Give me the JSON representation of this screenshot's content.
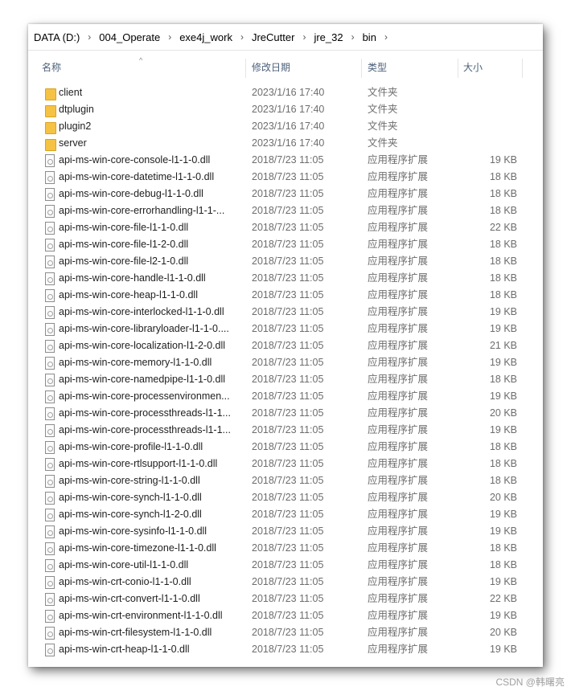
{
  "breadcrumb": [
    "DATA (D:)",
    "004_Operate",
    "exe4j_work",
    "JreCutter",
    "jre_32",
    "bin"
  ],
  "breadcrumb_separator": "›",
  "columns": {
    "name": "名称",
    "date": "修改日期",
    "type": "类型",
    "size": "大小"
  },
  "sort_arrow": "^",
  "files": [
    {
      "name": "client",
      "date": "2023/1/16 17:40",
      "type": "文件夹",
      "size": "",
      "icon": "folder-icon"
    },
    {
      "name": "dtplugin",
      "date": "2023/1/16 17:40",
      "type": "文件夹",
      "size": "",
      "icon": "folder-icon"
    },
    {
      "name": "plugin2",
      "date": "2023/1/16 17:40",
      "type": "文件夹",
      "size": "",
      "icon": "folder-icon"
    },
    {
      "name": "server",
      "date": "2023/1/16 17:40",
      "type": "文件夹",
      "size": "",
      "icon": "folder-icon"
    },
    {
      "name": "api-ms-win-core-console-l1-1-0.dll",
      "date": "2018/7/23 11:05",
      "type": "应用程序扩展",
      "size": "19 KB",
      "icon": "dll-file-icon"
    },
    {
      "name": "api-ms-win-core-datetime-l1-1-0.dll",
      "date": "2018/7/23 11:05",
      "type": "应用程序扩展",
      "size": "18 KB",
      "icon": "dll-file-icon"
    },
    {
      "name": "api-ms-win-core-debug-l1-1-0.dll",
      "date": "2018/7/23 11:05",
      "type": "应用程序扩展",
      "size": "18 KB",
      "icon": "dll-file-icon"
    },
    {
      "name": "api-ms-win-core-errorhandling-l1-1-...",
      "date": "2018/7/23 11:05",
      "type": "应用程序扩展",
      "size": "18 KB",
      "icon": "dll-file-icon"
    },
    {
      "name": "api-ms-win-core-file-l1-1-0.dll",
      "date": "2018/7/23 11:05",
      "type": "应用程序扩展",
      "size": "22 KB",
      "icon": "dll-file-icon"
    },
    {
      "name": "api-ms-win-core-file-l1-2-0.dll",
      "date": "2018/7/23 11:05",
      "type": "应用程序扩展",
      "size": "18 KB",
      "icon": "dll-file-icon"
    },
    {
      "name": "api-ms-win-core-file-l2-1-0.dll",
      "date": "2018/7/23 11:05",
      "type": "应用程序扩展",
      "size": "18 KB",
      "icon": "dll-file-icon"
    },
    {
      "name": "api-ms-win-core-handle-l1-1-0.dll",
      "date": "2018/7/23 11:05",
      "type": "应用程序扩展",
      "size": "18 KB",
      "icon": "dll-file-icon"
    },
    {
      "name": "api-ms-win-core-heap-l1-1-0.dll",
      "date": "2018/7/23 11:05",
      "type": "应用程序扩展",
      "size": "18 KB",
      "icon": "dll-file-icon"
    },
    {
      "name": "api-ms-win-core-interlocked-l1-1-0.dll",
      "date": "2018/7/23 11:05",
      "type": "应用程序扩展",
      "size": "19 KB",
      "icon": "dll-file-icon"
    },
    {
      "name": "api-ms-win-core-libraryloader-l1-1-0....",
      "date": "2018/7/23 11:05",
      "type": "应用程序扩展",
      "size": "19 KB",
      "icon": "dll-file-icon"
    },
    {
      "name": "api-ms-win-core-localization-l1-2-0.dll",
      "date": "2018/7/23 11:05",
      "type": "应用程序扩展",
      "size": "21 KB",
      "icon": "dll-file-icon"
    },
    {
      "name": "api-ms-win-core-memory-l1-1-0.dll",
      "date": "2018/7/23 11:05",
      "type": "应用程序扩展",
      "size": "19 KB",
      "icon": "dll-file-icon"
    },
    {
      "name": "api-ms-win-core-namedpipe-l1-1-0.dll",
      "date": "2018/7/23 11:05",
      "type": "应用程序扩展",
      "size": "18 KB",
      "icon": "dll-file-icon"
    },
    {
      "name": "api-ms-win-core-processenvironmen...",
      "date": "2018/7/23 11:05",
      "type": "应用程序扩展",
      "size": "19 KB",
      "icon": "dll-file-icon"
    },
    {
      "name": "api-ms-win-core-processthreads-l1-1...",
      "date": "2018/7/23 11:05",
      "type": "应用程序扩展",
      "size": "20 KB",
      "icon": "dll-file-icon"
    },
    {
      "name": "api-ms-win-core-processthreads-l1-1...",
      "date": "2018/7/23 11:05",
      "type": "应用程序扩展",
      "size": "19 KB",
      "icon": "dll-file-icon"
    },
    {
      "name": "api-ms-win-core-profile-l1-1-0.dll",
      "date": "2018/7/23 11:05",
      "type": "应用程序扩展",
      "size": "18 KB",
      "icon": "dll-file-icon"
    },
    {
      "name": "api-ms-win-core-rtlsupport-l1-1-0.dll",
      "date": "2018/7/23 11:05",
      "type": "应用程序扩展",
      "size": "18 KB",
      "icon": "dll-file-icon"
    },
    {
      "name": "api-ms-win-core-string-l1-1-0.dll",
      "date": "2018/7/23 11:05",
      "type": "应用程序扩展",
      "size": "18 KB",
      "icon": "dll-file-icon"
    },
    {
      "name": "api-ms-win-core-synch-l1-1-0.dll",
      "date": "2018/7/23 11:05",
      "type": "应用程序扩展",
      "size": "20 KB",
      "icon": "dll-file-icon"
    },
    {
      "name": "api-ms-win-core-synch-l1-2-0.dll",
      "date": "2018/7/23 11:05",
      "type": "应用程序扩展",
      "size": "19 KB",
      "icon": "dll-file-icon"
    },
    {
      "name": "api-ms-win-core-sysinfo-l1-1-0.dll",
      "date": "2018/7/23 11:05",
      "type": "应用程序扩展",
      "size": "19 KB",
      "icon": "dll-file-icon"
    },
    {
      "name": "api-ms-win-core-timezone-l1-1-0.dll",
      "date": "2018/7/23 11:05",
      "type": "应用程序扩展",
      "size": "18 KB",
      "icon": "dll-file-icon"
    },
    {
      "name": "api-ms-win-core-util-l1-1-0.dll",
      "date": "2018/7/23 11:05",
      "type": "应用程序扩展",
      "size": "18 KB",
      "icon": "dll-file-icon"
    },
    {
      "name": "api-ms-win-crt-conio-l1-1-0.dll",
      "date": "2018/7/23 11:05",
      "type": "应用程序扩展",
      "size": "19 KB",
      "icon": "dll-file-icon"
    },
    {
      "name": "api-ms-win-crt-convert-l1-1-0.dll",
      "date": "2018/7/23 11:05",
      "type": "应用程序扩展",
      "size": "22 KB",
      "icon": "dll-file-icon"
    },
    {
      "name": "api-ms-win-crt-environment-l1-1-0.dll",
      "date": "2018/7/23 11:05",
      "type": "应用程序扩展",
      "size": "19 KB",
      "icon": "dll-file-icon"
    },
    {
      "name": "api-ms-win-crt-filesystem-l1-1-0.dll",
      "date": "2018/7/23 11:05",
      "type": "应用程序扩展",
      "size": "20 KB",
      "icon": "dll-file-icon"
    },
    {
      "name": "api-ms-win-crt-heap-l1-1-0.dll",
      "date": "2018/7/23 11:05",
      "type": "应用程序扩展",
      "size": "19 KB",
      "icon": "dll-file-icon"
    }
  ],
  "watermark": "CSDN @韩曙亮"
}
